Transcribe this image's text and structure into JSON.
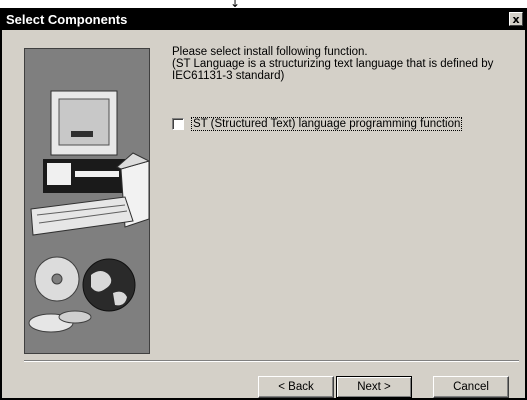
{
  "arrow": "↓",
  "window": {
    "title": "Select Components",
    "close_glyph": "x"
  },
  "description": {
    "line1": "Please select install following function.",
    "line2": "(ST Language is a structurizing text language that is defined by",
    "line3": "IEC61131-3 standard)"
  },
  "option": {
    "label": "ST (Structured Text) language programming function",
    "checked": false
  },
  "buttons": {
    "back": "< Back",
    "next": "Next >",
    "cancel": "Cancel"
  },
  "icons": {
    "art": "computer-with-cd-and-globe-illustration",
    "close": "close-icon"
  }
}
